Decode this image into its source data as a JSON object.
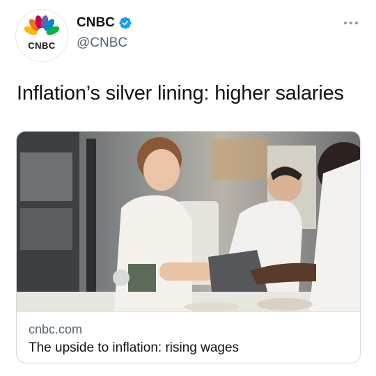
{
  "account": {
    "display_name": "CNBC",
    "handle": "@CNBC",
    "verified": true,
    "logo_text": "CNBC"
  },
  "tweet": {
    "text": "Inflation’s silver lining: higher salaries"
  },
  "card": {
    "domain": "cnbc.com",
    "title": "The upside to inflation: rising wages"
  },
  "colors": {
    "verified": "#1d9bf0",
    "secondary_text": "#536471",
    "border": "#cfd9de",
    "peacock": [
      "#fcb711",
      "#f37021",
      "#cc004c",
      "#6460aa",
      "#0089d0",
      "#0db14b"
    ]
  }
}
